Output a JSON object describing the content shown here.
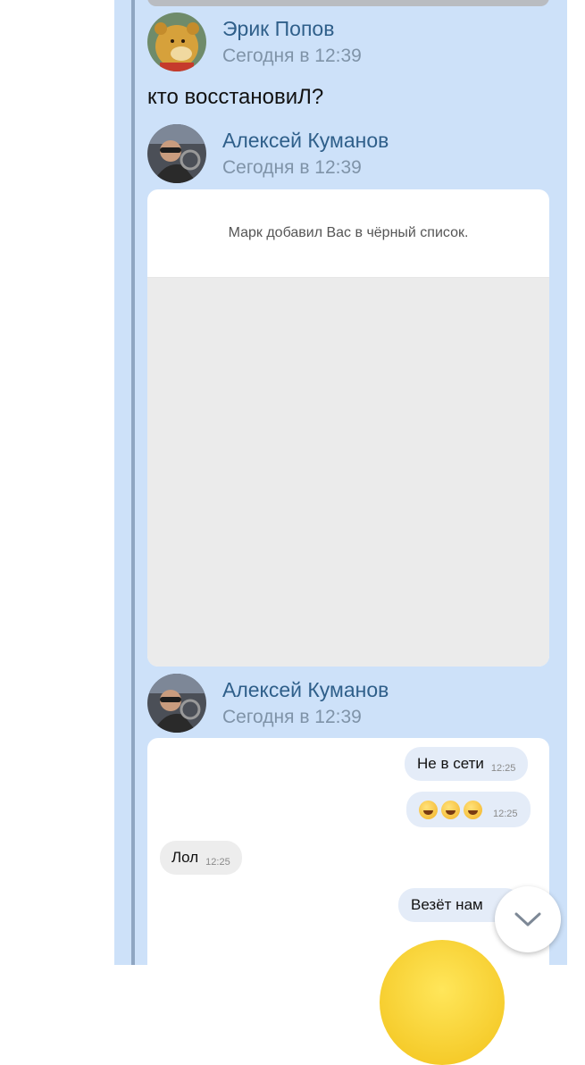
{
  "posts": [
    {
      "author": "Эрик Попов",
      "time": "Сегодня в 12:39",
      "text": "кто восстановиЛ?"
    },
    {
      "author": "Алексей Куманов",
      "time": "Сегодня в 12:39",
      "attachment_text": "Марк добавил Вас в чёрный список."
    },
    {
      "author": "Алексей Куманов",
      "time": "Сегодня в 12:39"
    }
  ],
  "chat": [
    {
      "text": "Не в сети",
      "time": "12:25",
      "dir": "out"
    },
    {
      "text": "",
      "emoji": [
        "rofl-emoji",
        "rofl-emoji",
        "rofl-emoji"
      ],
      "time": "12:25",
      "dir": "out"
    },
    {
      "text": "Лол",
      "time": "12:25",
      "dir": "in"
    },
    {
      "text": "Везёт нам",
      "time": "",
      "dir": "out"
    }
  ],
  "icons": {
    "scroll_down": "chevron-down-icon"
  },
  "colors": {
    "panel": "#cde1f9",
    "author": "#2f5f8a",
    "time": "#7f93a8"
  }
}
